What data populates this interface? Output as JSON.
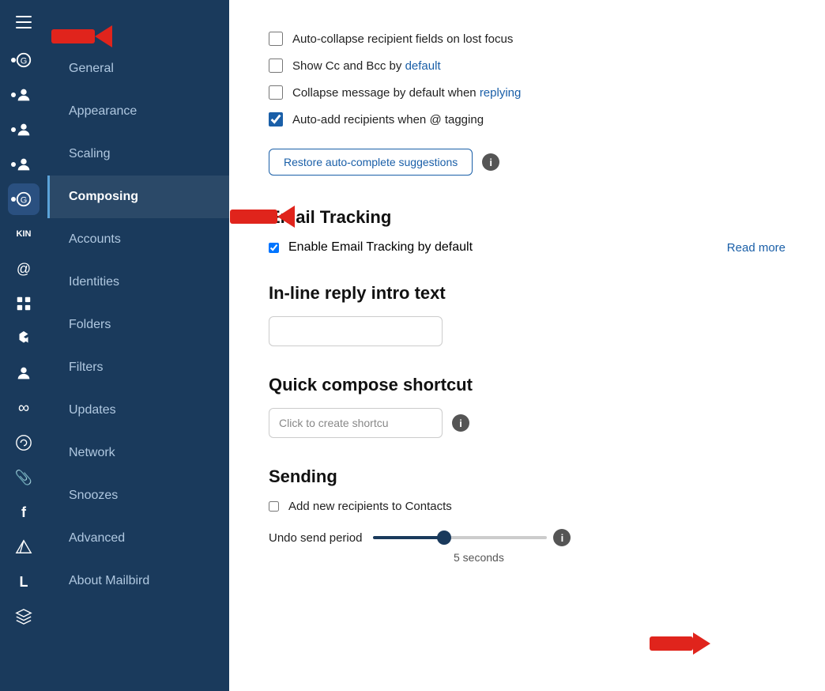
{
  "sidebar": {
    "nav_items": [
      {
        "id": "general",
        "label": "General",
        "active": false
      },
      {
        "id": "appearance",
        "label": "Appearance",
        "active": false
      },
      {
        "id": "scaling",
        "label": "Scaling",
        "active": false
      },
      {
        "id": "composing",
        "label": "Composing",
        "active": true
      },
      {
        "id": "accounts",
        "label": "Accounts",
        "active": false
      },
      {
        "id": "identities",
        "label": "Identities",
        "active": false
      },
      {
        "id": "folders",
        "label": "Folders",
        "active": false
      },
      {
        "id": "filters",
        "label": "Filters",
        "active": false
      },
      {
        "id": "updates",
        "label": "Updates",
        "active": false
      },
      {
        "id": "network",
        "label": "Network",
        "active": false
      },
      {
        "id": "snoozes",
        "label": "Snoozes",
        "active": false
      },
      {
        "id": "advanced",
        "label": "Advanced",
        "active": false
      },
      {
        "id": "about",
        "label": "About Mailbird",
        "active": false
      }
    ]
  },
  "main": {
    "checkboxes": [
      {
        "id": "auto_collapse",
        "label": "Auto-collapse recipient fields on lost focus",
        "checked": false
      },
      {
        "id": "show_cc",
        "label": "Show Cc and Bcc by ",
        "highlight": "default",
        "checked": false
      },
      {
        "id": "collapse_msg",
        "label": "Collapse message by default when replying",
        "highlight": "replying",
        "checked": false
      },
      {
        "id": "auto_add",
        "label": "Auto-add recipients when @ tagging",
        "checked": true
      }
    ],
    "restore_btn_label": "Restore auto-complete suggestions",
    "email_tracking": {
      "title": "Email Tracking",
      "checkbox_label": "Enable Email Tracking by default",
      "checked": true,
      "read_more": "Read more"
    },
    "inline_reply": {
      "title": "In-line reply intro text",
      "placeholder": ""
    },
    "quick_compose": {
      "title": "Quick compose shortcut",
      "btn_label": "Click to create shortcu"
    },
    "sending": {
      "title": "Sending",
      "add_recipients_label": "Add new recipients to Contacts",
      "add_recipients_checked": false,
      "undo_label": "Undo send period",
      "slider_value": 40,
      "seconds_label": "5 seconds"
    }
  },
  "icons": {
    "hamburger": "☰",
    "info": "i"
  }
}
